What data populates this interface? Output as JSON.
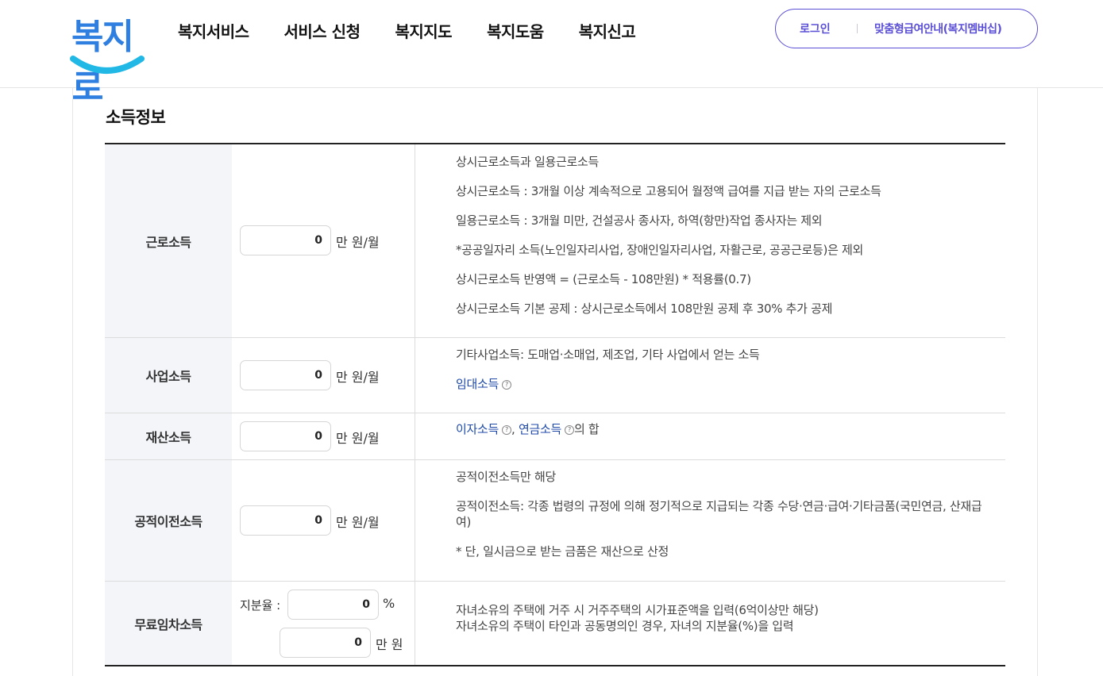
{
  "header": {
    "logo_text": "복지로",
    "nav": [
      "복지서비스",
      "서비스 신청",
      "복지지도",
      "복지도움",
      "복지신고"
    ],
    "util": {
      "login": "로그인",
      "membership": "맞춤형급여안내(복지멤버십)"
    }
  },
  "section": {
    "title": "소득정보"
  },
  "rows": {
    "earned": {
      "label": "근로소득",
      "value": "0",
      "unit": "만 원/월",
      "desc": [
        "상시근로소득과 일용근로소득",
        "상시근로소득 : 3개월 이상 계속적으로 고용되어 월정액 급여를 지급 받는 자의 근로소득",
        "일용근로소득 : 3개월 미만, 건설공사 종사자, 하역(항만)작업 종사자는 제외",
        "*공공일자리 소득(노인일자리사업, 장애인일자리사업, 자활근로, 공공근로등)은 제외",
        "상시근로소득 반영액 = (근로소득 - 108만원) * 적용률(0.7)",
        "상시근로소득 기본 공제 : 상시근로소득에서 108만원 공제 후 30% 추가 공제"
      ]
    },
    "business": {
      "label": "사업소득",
      "value": "0",
      "unit": "만 원/월",
      "desc": "기타사업소득: 도매업·소매업, 제조업, 기타 사업에서 얻는 소득",
      "link": "임대소득"
    },
    "property": {
      "label": "재산소득",
      "value": "0",
      "unit": "만 원/월",
      "link1": "이자소득",
      "sep": ",",
      "link2": "연금소득",
      "suffix": "의 합"
    },
    "transfer": {
      "label": "공적이전소득",
      "value": "0",
      "unit": "만 원/월",
      "desc": [
        "공적이전소득만 해당",
        "공적이전소득: 각종 법령의 규정에 의해 정기적으로 지급되는 각종 수당·연금·급여·기타금품(국민연금, 산재급여)",
        "* 단, 일시금으로 받는 금품은 재산으로 산정"
      ]
    },
    "rentfree": {
      "label": "무료임차소득",
      "share_label": "지분율 :",
      "share_value": "0",
      "share_unit": "%",
      "amount_value": "0",
      "amount_unit": "만 원",
      "desc": [
        "자녀소유의 주택에 거주 시 거주주택의 시가표준액을 입력(6억이상만 해당)",
        "자녀소유의 주택이 타인과 공동명의인 경우, 자녀의 지분율(%)을 입력"
      ]
    }
  },
  "help_icon_glyph": "?"
}
